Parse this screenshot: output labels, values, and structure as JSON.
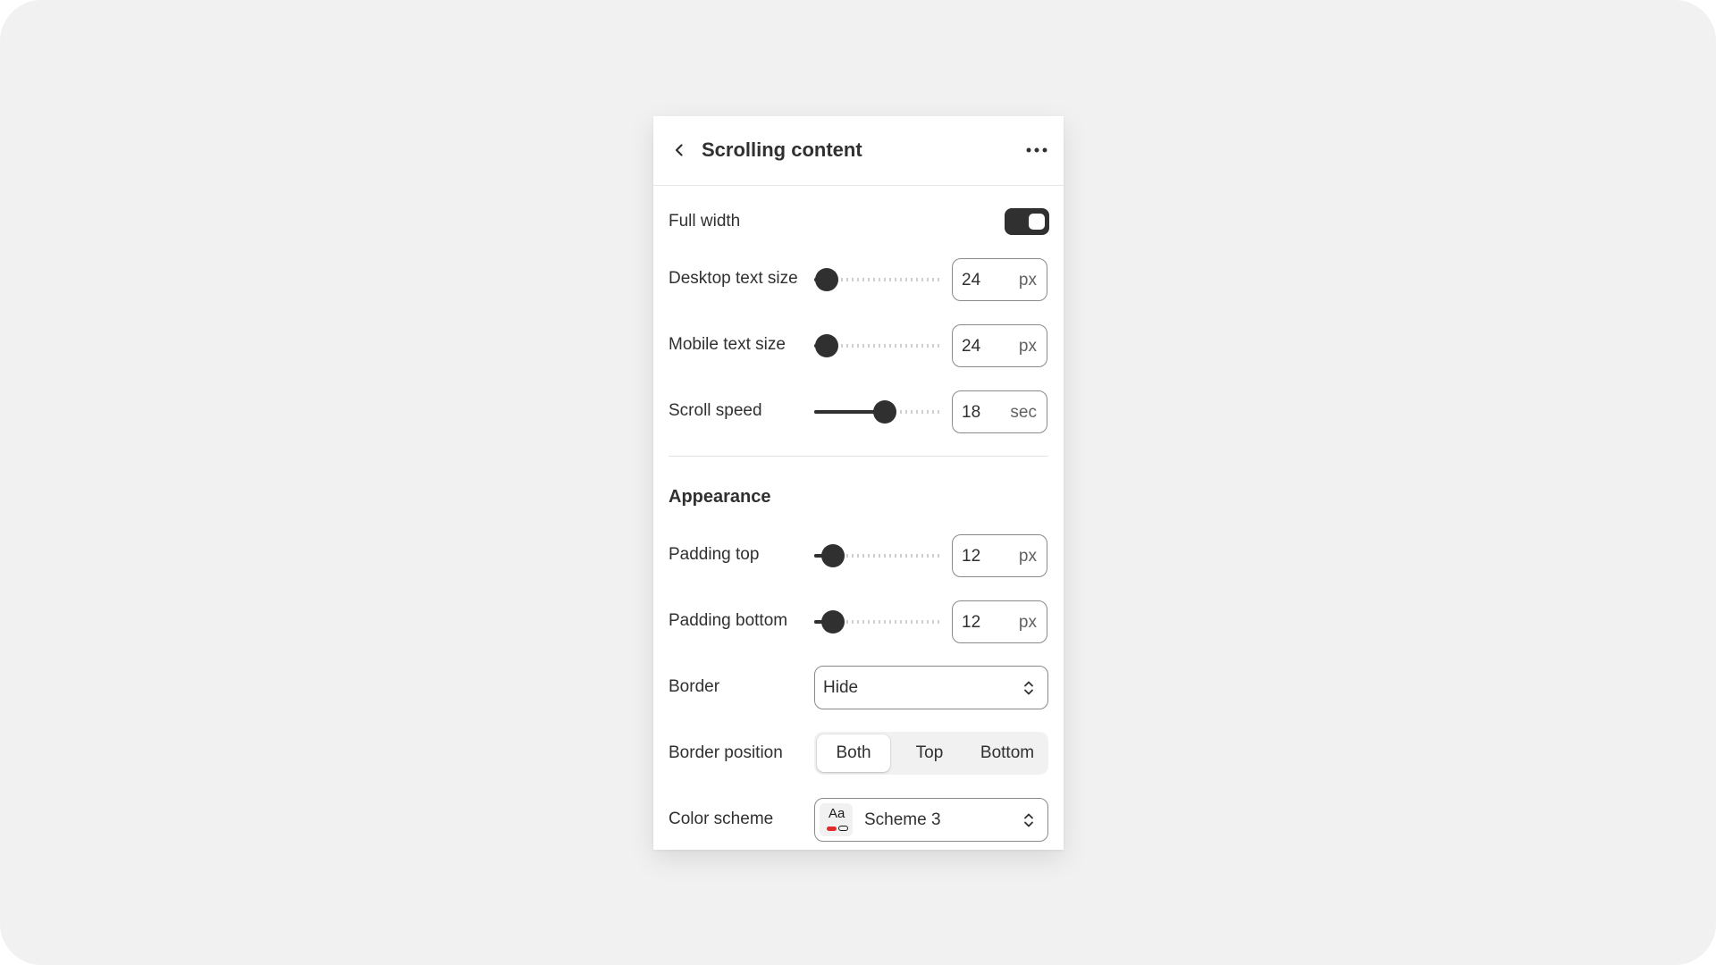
{
  "panel": {
    "title": "Scrolling content"
  },
  "settings": {
    "full_width": {
      "label": "Full width",
      "enabled": true
    },
    "desktop_text_size": {
      "label": "Desktop text size",
      "value": "24",
      "unit": "px",
      "level": 0.1
    },
    "mobile_text_size": {
      "label": "Mobile text size",
      "value": "24",
      "unit": "px",
      "level": 0.1
    },
    "scroll_speed": {
      "label": "Scroll speed",
      "value": "18",
      "unit": "sec",
      "level": 0.55
    }
  },
  "appearance": {
    "heading": "Appearance",
    "padding_top": {
      "label": "Padding top",
      "value": "12",
      "unit": "px",
      "level": 0.15
    },
    "padding_bottom": {
      "label": "Padding bottom",
      "value": "12",
      "unit": "px",
      "level": 0.15
    },
    "border": {
      "label": "Border",
      "value": "Hide"
    },
    "border_position": {
      "label": "Border position",
      "options": [
        "Both",
        "Top",
        "Bottom"
      ],
      "selected": "Both"
    },
    "color_scheme": {
      "label": "Color scheme",
      "swatch_text": "Aa",
      "value": "Scheme 3"
    }
  },
  "icons": {
    "back": "chevron-left-icon",
    "more": "more-horizontal-icon",
    "select": "chevron-up-down-icon"
  },
  "colors": {
    "primary": "#303030",
    "background": "#f1f1f1",
    "swatch_accent": "#e22a2a"
  }
}
